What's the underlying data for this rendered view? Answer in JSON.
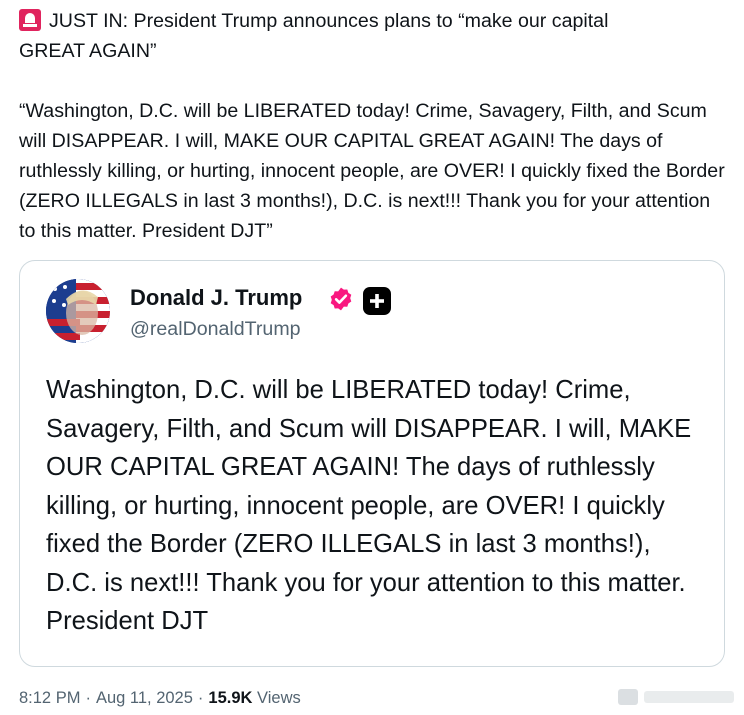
{
  "post": {
    "headline_prefix": "JUST IN: President Trump announces plans to “make our capital",
    "headline_suffix": "GREAT AGAIN”",
    "quote_paragraph": "“Washington, D.C. will be LIBERATED today! Crime, Savagery, Filth, and Scum will DISAPPEAR. I will, MAKE OUR CAPITAL GREAT AGAIN! The days of ruthlessly killing, or hurting, innocent people, are OVER! I quickly fixed the Border (ZERO ILLEGALS in last 3 months!), D.C. is next!!! Thank you for your attention to this matter. President DJT”",
    "icon": "siren-icon"
  },
  "quoted_post": {
    "author_name": "Donald J. Trump",
    "author_handle": "@realDonaldTrump",
    "body": "Washington, D.C. will be LIBERATED today! Crime, Savagery, Filth, and Scum will DISAPPEAR. I will, MAKE OUR CAPITAL GREAT AGAIN! The days of ruthlessly killing, or hurting, innocent people, are OVER! I quickly fixed the Border (ZERO ILLEGALS in last 3 months!), D.C. is next!!! Thank you for your attention to this matter. President DJT",
    "badges": [
      "verified-icon",
      "plus-badge-icon"
    ],
    "verified_color": "#f91880"
  },
  "meta": {
    "time": "8:12 PM",
    "date": "Aug 11, 2025",
    "views_count": "15.9K",
    "views_label": "Views"
  }
}
